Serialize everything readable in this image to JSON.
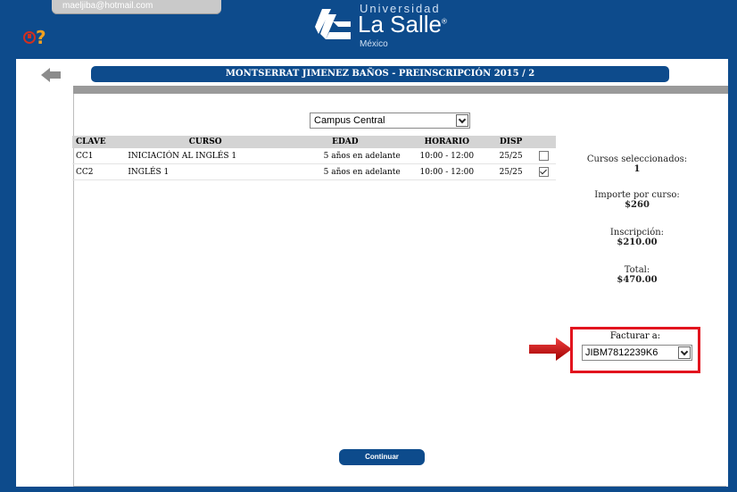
{
  "header": {
    "user_email": "maeljiba@hotmail.com",
    "logo_line1": "Universidad",
    "logo_name": "La Salle",
    "logo_country": "México"
  },
  "page": {
    "title": "MONTSERRAT JIMENEZ BAÑOS - PREINSCRIPCIÓN 2015 / 2"
  },
  "campus_select": {
    "value": "Campus Central"
  },
  "table": {
    "headers": [
      "CLAVE",
      "CURSO",
      "EDAD",
      "HORARIO",
      "DISP"
    ],
    "rows": [
      {
        "clave": "CC1",
        "curso": "INICIACIÓN AL INGLÉS 1",
        "edad": "5 años en adelante",
        "horario": "10:00 - 12:00",
        "disp": "25/25",
        "checked": false
      },
      {
        "clave": "CC2",
        "curso": "INGLÉS 1",
        "edad": "5 años en adelante",
        "horario": "10:00 - 12:00",
        "disp": "25/25",
        "checked": true
      }
    ]
  },
  "summary": {
    "selected_label": "Cursos seleccionados:",
    "selected_value": "1",
    "importe_label": "Importe por curso:",
    "importe_value": "$260",
    "inscripcion_label": "Inscripción:",
    "inscripcion_value": "$210.00",
    "total_label": "Total:",
    "total_value": "$470.00"
  },
  "facturar": {
    "label": "Facturar a:",
    "value": "JIBM7812239K6"
  },
  "buttons": {
    "continue_label": "Continuar"
  },
  "colors": {
    "brand_blue": "#0d4b8c",
    "highlight_red": "#e2141e"
  }
}
